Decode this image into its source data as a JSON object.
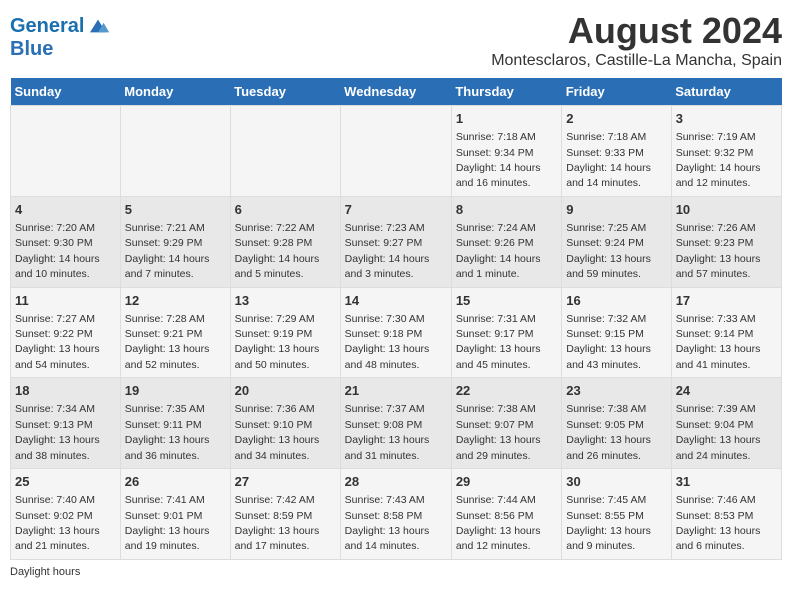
{
  "logo": {
    "line1": "General",
    "line2": "Blue"
  },
  "title": "August 2024",
  "subtitle": "Montesclaros, Castille-La Mancha, Spain",
  "days_of_week": [
    "Sunday",
    "Monday",
    "Tuesday",
    "Wednesday",
    "Thursday",
    "Friday",
    "Saturday"
  ],
  "weeks": [
    [
      {
        "day": "",
        "info": ""
      },
      {
        "day": "",
        "info": ""
      },
      {
        "day": "",
        "info": ""
      },
      {
        "day": "",
        "info": ""
      },
      {
        "day": "1",
        "info": "Sunrise: 7:18 AM\nSunset: 9:34 PM\nDaylight: 14 hours and 16 minutes."
      },
      {
        "day": "2",
        "info": "Sunrise: 7:18 AM\nSunset: 9:33 PM\nDaylight: 14 hours and 14 minutes."
      },
      {
        "day": "3",
        "info": "Sunrise: 7:19 AM\nSunset: 9:32 PM\nDaylight: 14 hours and 12 minutes."
      }
    ],
    [
      {
        "day": "4",
        "info": "Sunrise: 7:20 AM\nSunset: 9:30 PM\nDaylight: 14 hours and 10 minutes."
      },
      {
        "day": "5",
        "info": "Sunrise: 7:21 AM\nSunset: 9:29 PM\nDaylight: 14 hours and 7 minutes."
      },
      {
        "day": "6",
        "info": "Sunrise: 7:22 AM\nSunset: 9:28 PM\nDaylight: 14 hours and 5 minutes."
      },
      {
        "day": "7",
        "info": "Sunrise: 7:23 AM\nSunset: 9:27 PM\nDaylight: 14 hours and 3 minutes."
      },
      {
        "day": "8",
        "info": "Sunrise: 7:24 AM\nSunset: 9:26 PM\nDaylight: 14 hours and 1 minute."
      },
      {
        "day": "9",
        "info": "Sunrise: 7:25 AM\nSunset: 9:24 PM\nDaylight: 13 hours and 59 minutes."
      },
      {
        "day": "10",
        "info": "Sunrise: 7:26 AM\nSunset: 9:23 PM\nDaylight: 13 hours and 57 minutes."
      }
    ],
    [
      {
        "day": "11",
        "info": "Sunrise: 7:27 AM\nSunset: 9:22 PM\nDaylight: 13 hours and 54 minutes."
      },
      {
        "day": "12",
        "info": "Sunrise: 7:28 AM\nSunset: 9:21 PM\nDaylight: 13 hours and 52 minutes."
      },
      {
        "day": "13",
        "info": "Sunrise: 7:29 AM\nSunset: 9:19 PM\nDaylight: 13 hours and 50 minutes."
      },
      {
        "day": "14",
        "info": "Sunrise: 7:30 AM\nSunset: 9:18 PM\nDaylight: 13 hours and 48 minutes."
      },
      {
        "day": "15",
        "info": "Sunrise: 7:31 AM\nSunset: 9:17 PM\nDaylight: 13 hours and 45 minutes."
      },
      {
        "day": "16",
        "info": "Sunrise: 7:32 AM\nSunset: 9:15 PM\nDaylight: 13 hours and 43 minutes."
      },
      {
        "day": "17",
        "info": "Sunrise: 7:33 AM\nSunset: 9:14 PM\nDaylight: 13 hours and 41 minutes."
      }
    ],
    [
      {
        "day": "18",
        "info": "Sunrise: 7:34 AM\nSunset: 9:13 PM\nDaylight: 13 hours and 38 minutes."
      },
      {
        "day": "19",
        "info": "Sunrise: 7:35 AM\nSunset: 9:11 PM\nDaylight: 13 hours and 36 minutes."
      },
      {
        "day": "20",
        "info": "Sunrise: 7:36 AM\nSunset: 9:10 PM\nDaylight: 13 hours and 34 minutes."
      },
      {
        "day": "21",
        "info": "Sunrise: 7:37 AM\nSunset: 9:08 PM\nDaylight: 13 hours and 31 minutes."
      },
      {
        "day": "22",
        "info": "Sunrise: 7:38 AM\nSunset: 9:07 PM\nDaylight: 13 hours and 29 minutes."
      },
      {
        "day": "23",
        "info": "Sunrise: 7:38 AM\nSunset: 9:05 PM\nDaylight: 13 hours and 26 minutes."
      },
      {
        "day": "24",
        "info": "Sunrise: 7:39 AM\nSunset: 9:04 PM\nDaylight: 13 hours and 24 minutes."
      }
    ],
    [
      {
        "day": "25",
        "info": "Sunrise: 7:40 AM\nSunset: 9:02 PM\nDaylight: 13 hours and 21 minutes."
      },
      {
        "day": "26",
        "info": "Sunrise: 7:41 AM\nSunset: 9:01 PM\nDaylight: 13 hours and 19 minutes."
      },
      {
        "day": "27",
        "info": "Sunrise: 7:42 AM\nSunset: 8:59 PM\nDaylight: 13 hours and 17 minutes."
      },
      {
        "day": "28",
        "info": "Sunrise: 7:43 AM\nSunset: 8:58 PM\nDaylight: 13 hours and 14 minutes."
      },
      {
        "day": "29",
        "info": "Sunrise: 7:44 AM\nSunset: 8:56 PM\nDaylight: 13 hours and 12 minutes."
      },
      {
        "day": "30",
        "info": "Sunrise: 7:45 AM\nSunset: 8:55 PM\nDaylight: 13 hours and 9 minutes."
      },
      {
        "day": "31",
        "info": "Sunrise: 7:46 AM\nSunset: 8:53 PM\nDaylight: 13 hours and 6 minutes."
      }
    ]
  ],
  "footer": {
    "daylight_label": "Daylight hours"
  }
}
